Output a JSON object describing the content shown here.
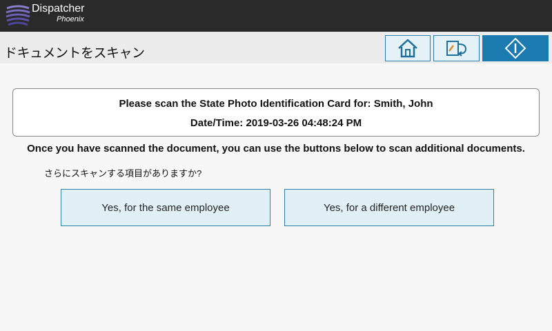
{
  "brand": {
    "name": "Dispatcher",
    "sub": "Phoenix"
  },
  "header": {
    "title": "ドキュメントをスキャン"
  },
  "toolbar": {
    "home_icon": "home-icon",
    "rescan_icon": "rescan-icon",
    "start_icon": "start-icon"
  },
  "info": {
    "line1": "Please scan the State Photo Identification Card for: Smith, John",
    "line2": "Date/Time: 2019-03-26 04:48:24 PM"
  },
  "instruction": "Once you have scanned the document, you can use the buttons below to scan additional documents.",
  "question": "さらにスキャンする項目がありますか?",
  "buttons": {
    "same": "Yes, for the same employee",
    "different": "Yes, for a different employee"
  },
  "colors": {
    "accent": "#1b7ab0",
    "button_bg": "#e1f0f6",
    "topbar": "#2a2a2a"
  }
}
